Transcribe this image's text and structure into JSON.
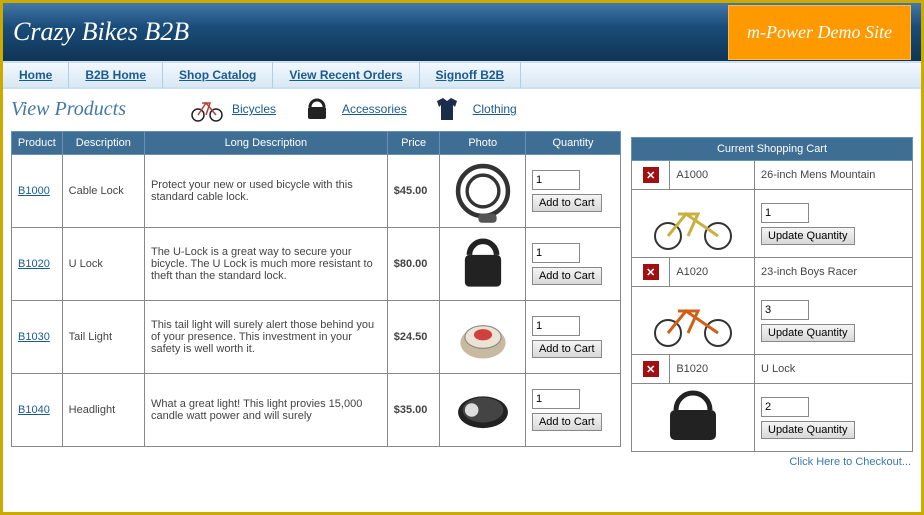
{
  "header": {
    "title": "Crazy Bikes B2B",
    "demo": "m-Power Demo Site"
  },
  "nav": [
    "Home",
    "B2B Home",
    "Shop Catalog",
    "View Recent Orders",
    "Signoff B2B"
  ],
  "page_title": "View Products",
  "categories": [
    {
      "label": "Bicycles"
    },
    {
      "label": "Accessories"
    },
    {
      "label": "Clothing"
    }
  ],
  "product_columns": [
    "Product",
    "Description",
    "Long Description",
    "Price",
    "Photo",
    "Quantity"
  ],
  "products": [
    {
      "code": "B1000",
      "desc": "Cable Lock",
      "long": "Protect your new or used bicycle with this standard cable lock.",
      "price": "$45.00",
      "qty": "1"
    },
    {
      "code": "B1020",
      "desc": "U Lock",
      "long": "The U-Lock is a great way to secure your bicycle. The U Lock is much more resistant to theft than the standard lock.",
      "price": "$80.00",
      "qty": "1"
    },
    {
      "code": "B1030",
      "desc": "Tail Light",
      "long": "This tail light will surely alert those behind you of your presence. This investment in your safety is well worth it.",
      "price": "$24.50",
      "qty": "1"
    },
    {
      "code": "B1040",
      "desc": "Headlight",
      "long": "What a great light! This light provies 15,000 candle watt power and will surely",
      "price": "$35.00",
      "qty": "1"
    }
  ],
  "btn_add": "Add to Cart",
  "cart_header": "Current Shopping Cart",
  "cart_items": [
    {
      "code": "A1000",
      "name": "26-inch Mens Mountain",
      "qty": "1"
    },
    {
      "code": "A1020",
      "name": "23-inch Boys Racer",
      "qty": "3"
    },
    {
      "code": "B1020",
      "name": "U Lock",
      "qty": "2"
    }
  ],
  "btn_update": "Update Quantity",
  "checkout_text": "Click Here to Checkout..."
}
